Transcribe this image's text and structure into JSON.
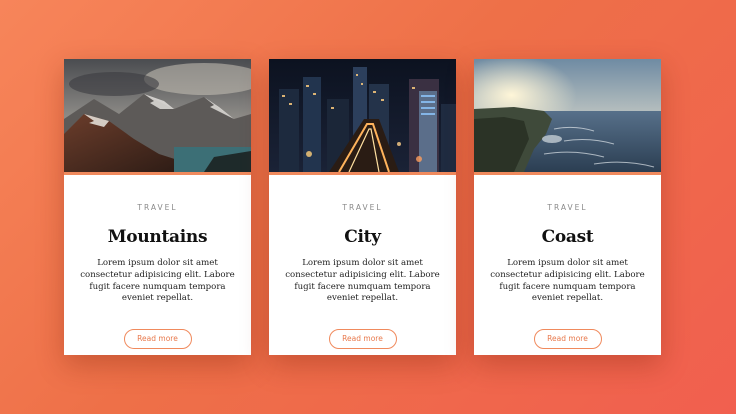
{
  "cards": [
    {
      "category": "TRAVEL",
      "title": "Mountains",
      "text": "Lorem ipsum dolor sit amet consectetur adipisicing elit. Labore fugit facere numquam tempora eveniet repellat.",
      "button_label": "Read more",
      "image": "mountains-photo"
    },
    {
      "category": "TRAVEL",
      "title": "City",
      "text": "Lorem ipsum dolor sit amet consectetur adipisicing elit. Labore fugit facere numquam tempora eveniet repellat.",
      "button_label": "Read more",
      "image": "city-photo"
    },
    {
      "category": "TRAVEL",
      "title": "Coast",
      "text": "Lorem ipsum dolor sit amet consectetur adipisicing elit. Labore fugit facere numquam tempora eveniet repellat.",
      "button_label": "Read more",
      "image": "coast-photo"
    }
  ],
  "colors": {
    "background_start": "#f7855a",
    "background_end": "#f15f4f",
    "accent": "#f08a5d",
    "card": "#ffffff"
  }
}
